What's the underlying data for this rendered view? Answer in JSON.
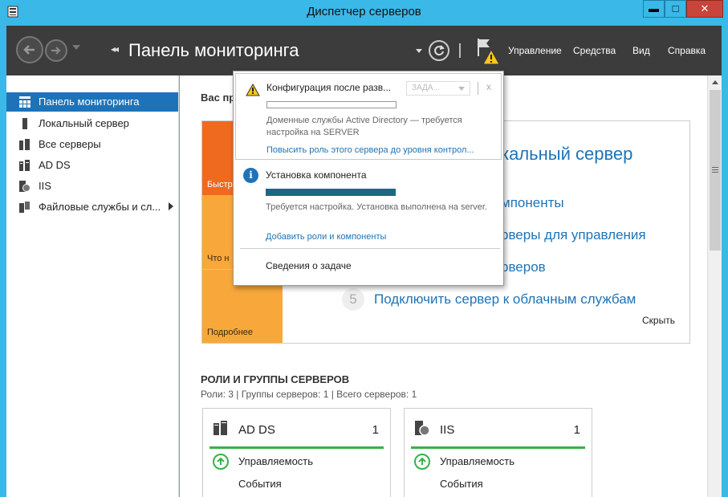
{
  "window": {
    "title": "Диспетчер серверов",
    "controls": {
      "minimize": "▬",
      "maximize": "□",
      "close": "✕"
    }
  },
  "header": {
    "breadcrumb_arrows": "◂◂",
    "page_title": "Панель мониторинга",
    "menu": {
      "manage": "Управление",
      "tools": "Средства",
      "view": "Вид",
      "help": "Справка"
    }
  },
  "sidebar": {
    "items": [
      {
        "label": "Панель мониторинга",
        "icon": "dashboard-grid-icon",
        "active": true
      },
      {
        "label": "Локальный сервер",
        "icon": "server-icon"
      },
      {
        "label": "Все серверы",
        "icon": "servers-icon"
      },
      {
        "label": "AD DS",
        "icon": "ad-ds-icon"
      },
      {
        "label": "IIS",
        "icon": "iis-icon"
      },
      {
        "label": "Файловые службы и сл...",
        "icon": "file-services-icon",
        "has_submenu": true
      }
    ]
  },
  "main": {
    "welcome_title": "Вас пр",
    "quick_start": {
      "tiles": [
        "Быстр",
        "Что н",
        "Подробнее"
      ],
      "big_title": "кальный сервер",
      "links": [
        "мпоненты",
        "рверы для управления",
        "рверов"
      ],
      "step_number": "5",
      "step_link": "Подключить сервер к облачным службам",
      "hide": "Скрыть"
    },
    "roles": {
      "title": "РОЛИ И ГРУППЫ СЕРВЕРОВ",
      "subtitle": "Роли: 3 | Группы серверов: 1 | Всего серверов: 1",
      "cards": [
        {
          "name": "AD DS",
          "count": "1",
          "manageability": "Управляемость",
          "events": "События"
        },
        {
          "name": "IIS",
          "count": "1",
          "manageability": "Управляемость",
          "events": "События"
        }
      ]
    }
  },
  "notifications": {
    "item1": {
      "title": "Конфигурация после разв...",
      "task_button": "ЗАДА...",
      "close": "x",
      "text": "Доменные службы Active Directory — требуется настройка на SERVER",
      "link": "Повысить роль этого сервера до уровня контрол..."
    },
    "item2": {
      "title": "Установка компонента",
      "progress": 1.0,
      "text": "Требуется настройка. Установка выполнена на server.",
      "link": "Добавить роли и компоненты"
    },
    "details": "Сведения о задаче"
  },
  "colors": {
    "titlebar": "#3ab8e8",
    "header": "#3c3c3c",
    "accent": "#1e73b8",
    "tile_orange": "#ef6a1f",
    "tile_light": "#f8a83a",
    "status_green": "#36b24a",
    "progress": "#1a6883"
  }
}
